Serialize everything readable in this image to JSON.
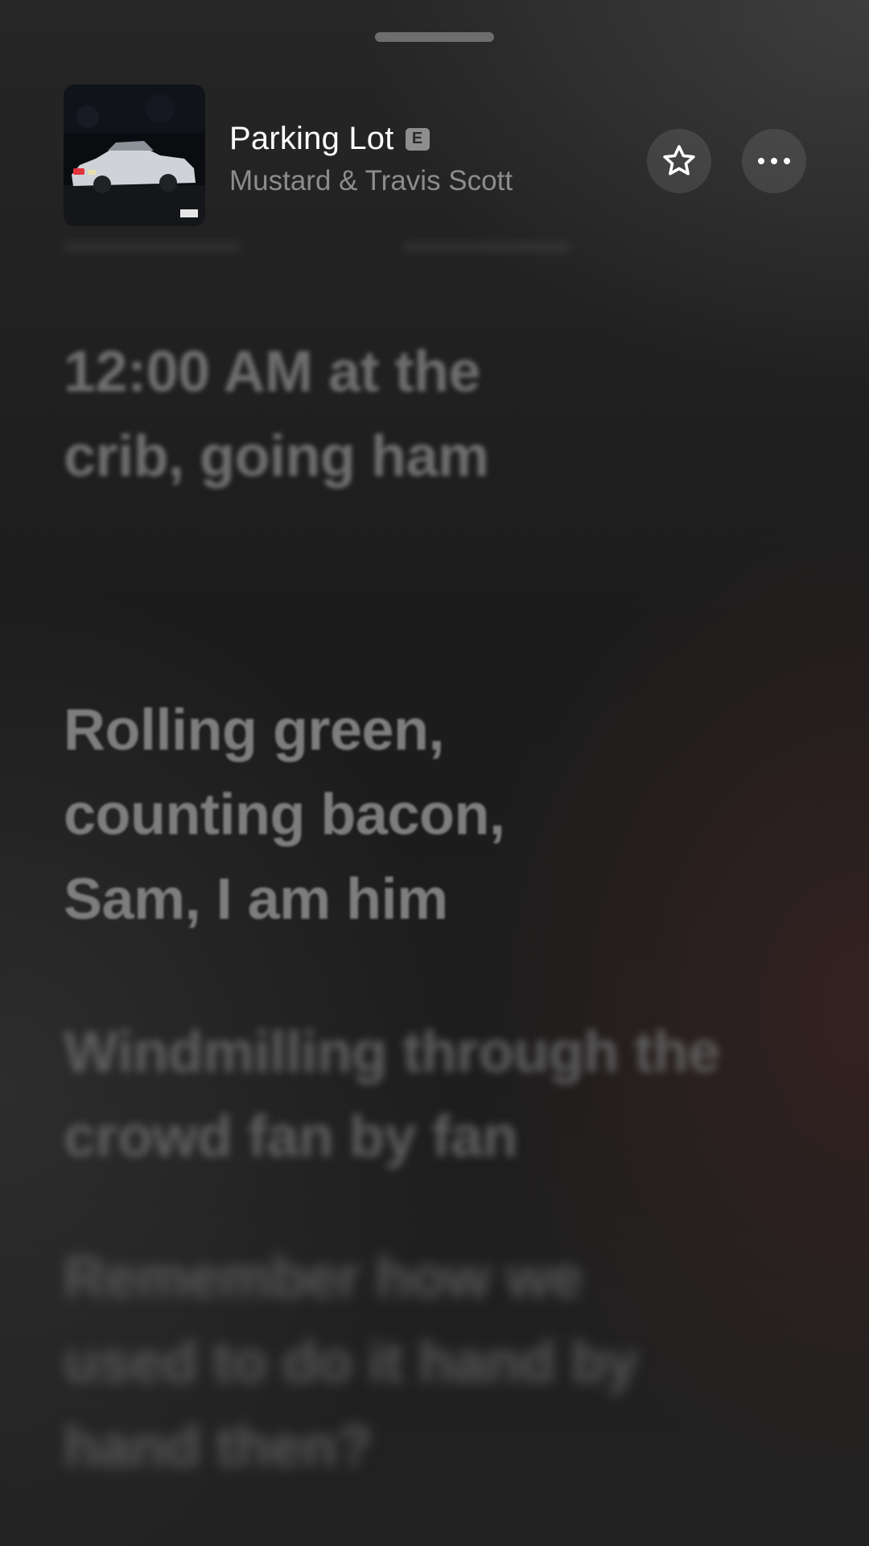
{
  "now_playing": {
    "title": "Parking Lot",
    "explicit_badge": "E",
    "artist": "Mustard & Travis Scott",
    "artwork_icon": "album-artwork"
  },
  "actions": {
    "favorite_icon": "star-icon",
    "more_icon": "more-icon"
  },
  "lyrics": {
    "lines": [
      "12:00 AM at the crib, going ham",
      "Rolling green, counting bacon, Sam, I am him",
      "Windmilling through the crowd fan by fan",
      "Remember how we used to do it hand by hand then?"
    ]
  },
  "colors": {
    "background": "#1f1f1f",
    "title": "#ffffff",
    "artist": "#8c8c8c",
    "badge": "#8e8e8e"
  }
}
